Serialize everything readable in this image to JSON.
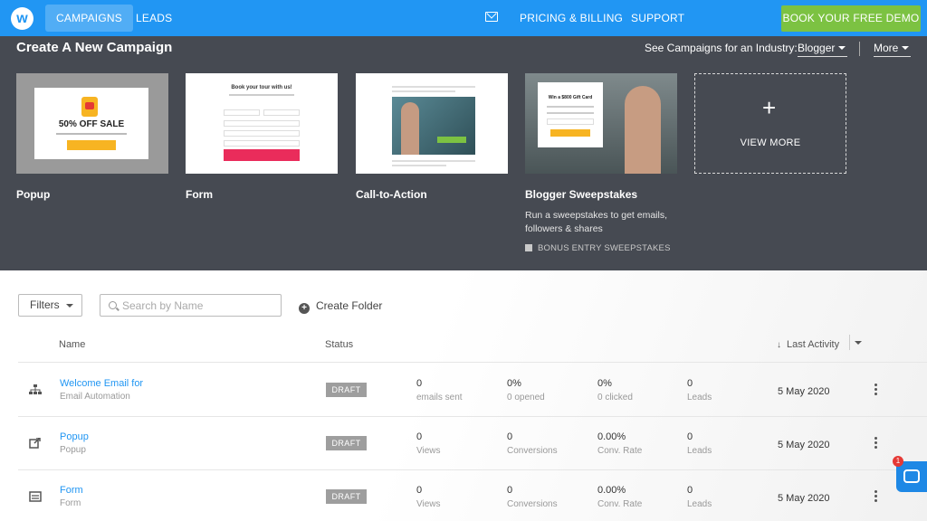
{
  "nav": {
    "logo": "w",
    "campaigns": "CAMPAIGNS",
    "leads": "LEADS",
    "pricing": "PRICING & BILLING",
    "support": "SUPPORT",
    "demo_button": "BOOK YOUR FREE DEMO",
    "mail_icon": "mail-icon"
  },
  "create": {
    "title": "Create A New Campaign",
    "industry_label": "See Campaigns for an Industry:",
    "industry_value": "Blogger",
    "more": "More",
    "view_more": "VIEW MORE",
    "cards": [
      {
        "label": "Popup",
        "preview_text": "50% OFF SALE"
      },
      {
        "label": "Form",
        "preview_text": "Book your tour with us!"
      },
      {
        "label": "Call-to-Action",
        "preview_text": "Transform Your Body in 8 Weeks"
      },
      {
        "label": "Blogger Sweepstakes",
        "preview_text": "Win a $800 Gift Card",
        "description": "Run a sweepstakes to get emails, followers & shares",
        "bonus": "BONUS ENTRY SWEEPSTAKES"
      }
    ]
  },
  "toolbar": {
    "filters": "Filters",
    "search_placeholder": "Search by Name",
    "create_folder": "Create Folder"
  },
  "table": {
    "headers": {
      "name": "Name",
      "status": "Status",
      "last_activity": "Last Activity"
    },
    "rows": [
      {
        "icon": "sitemap-icon",
        "name": "Welcome Email for",
        "type": "Email Automation",
        "status": "DRAFT",
        "s1v": "0",
        "s1l": "emails sent",
        "s2v": "0%",
        "s2l": "0 opened",
        "s3v": "0%",
        "s3l": "0 clicked",
        "s4v": "0",
        "s4l": "Leads",
        "date": "5 May 2020"
      },
      {
        "icon": "external-link-icon",
        "name": "Popup",
        "type": "Popup",
        "status": "DRAFT",
        "s1v": "0",
        "s1l": "Views",
        "s2v": "0",
        "s2l": "Conversions",
        "s3v": "0.00%",
        "s3l": "Conv. Rate",
        "s4v": "0",
        "s4l": "Leads",
        "date": "5 May 2020"
      },
      {
        "icon": "form-icon",
        "name": "Form",
        "type": "Form",
        "status": "DRAFT",
        "s1v": "0",
        "s1l": "Views",
        "s2v": "0",
        "s2l": "Conversions",
        "s3v": "0.00%",
        "s3l": "Conv. Rate",
        "s4v": "0",
        "s4l": "Leads",
        "date": "5 May 2020"
      }
    ]
  },
  "chat": {
    "badge": "1"
  }
}
